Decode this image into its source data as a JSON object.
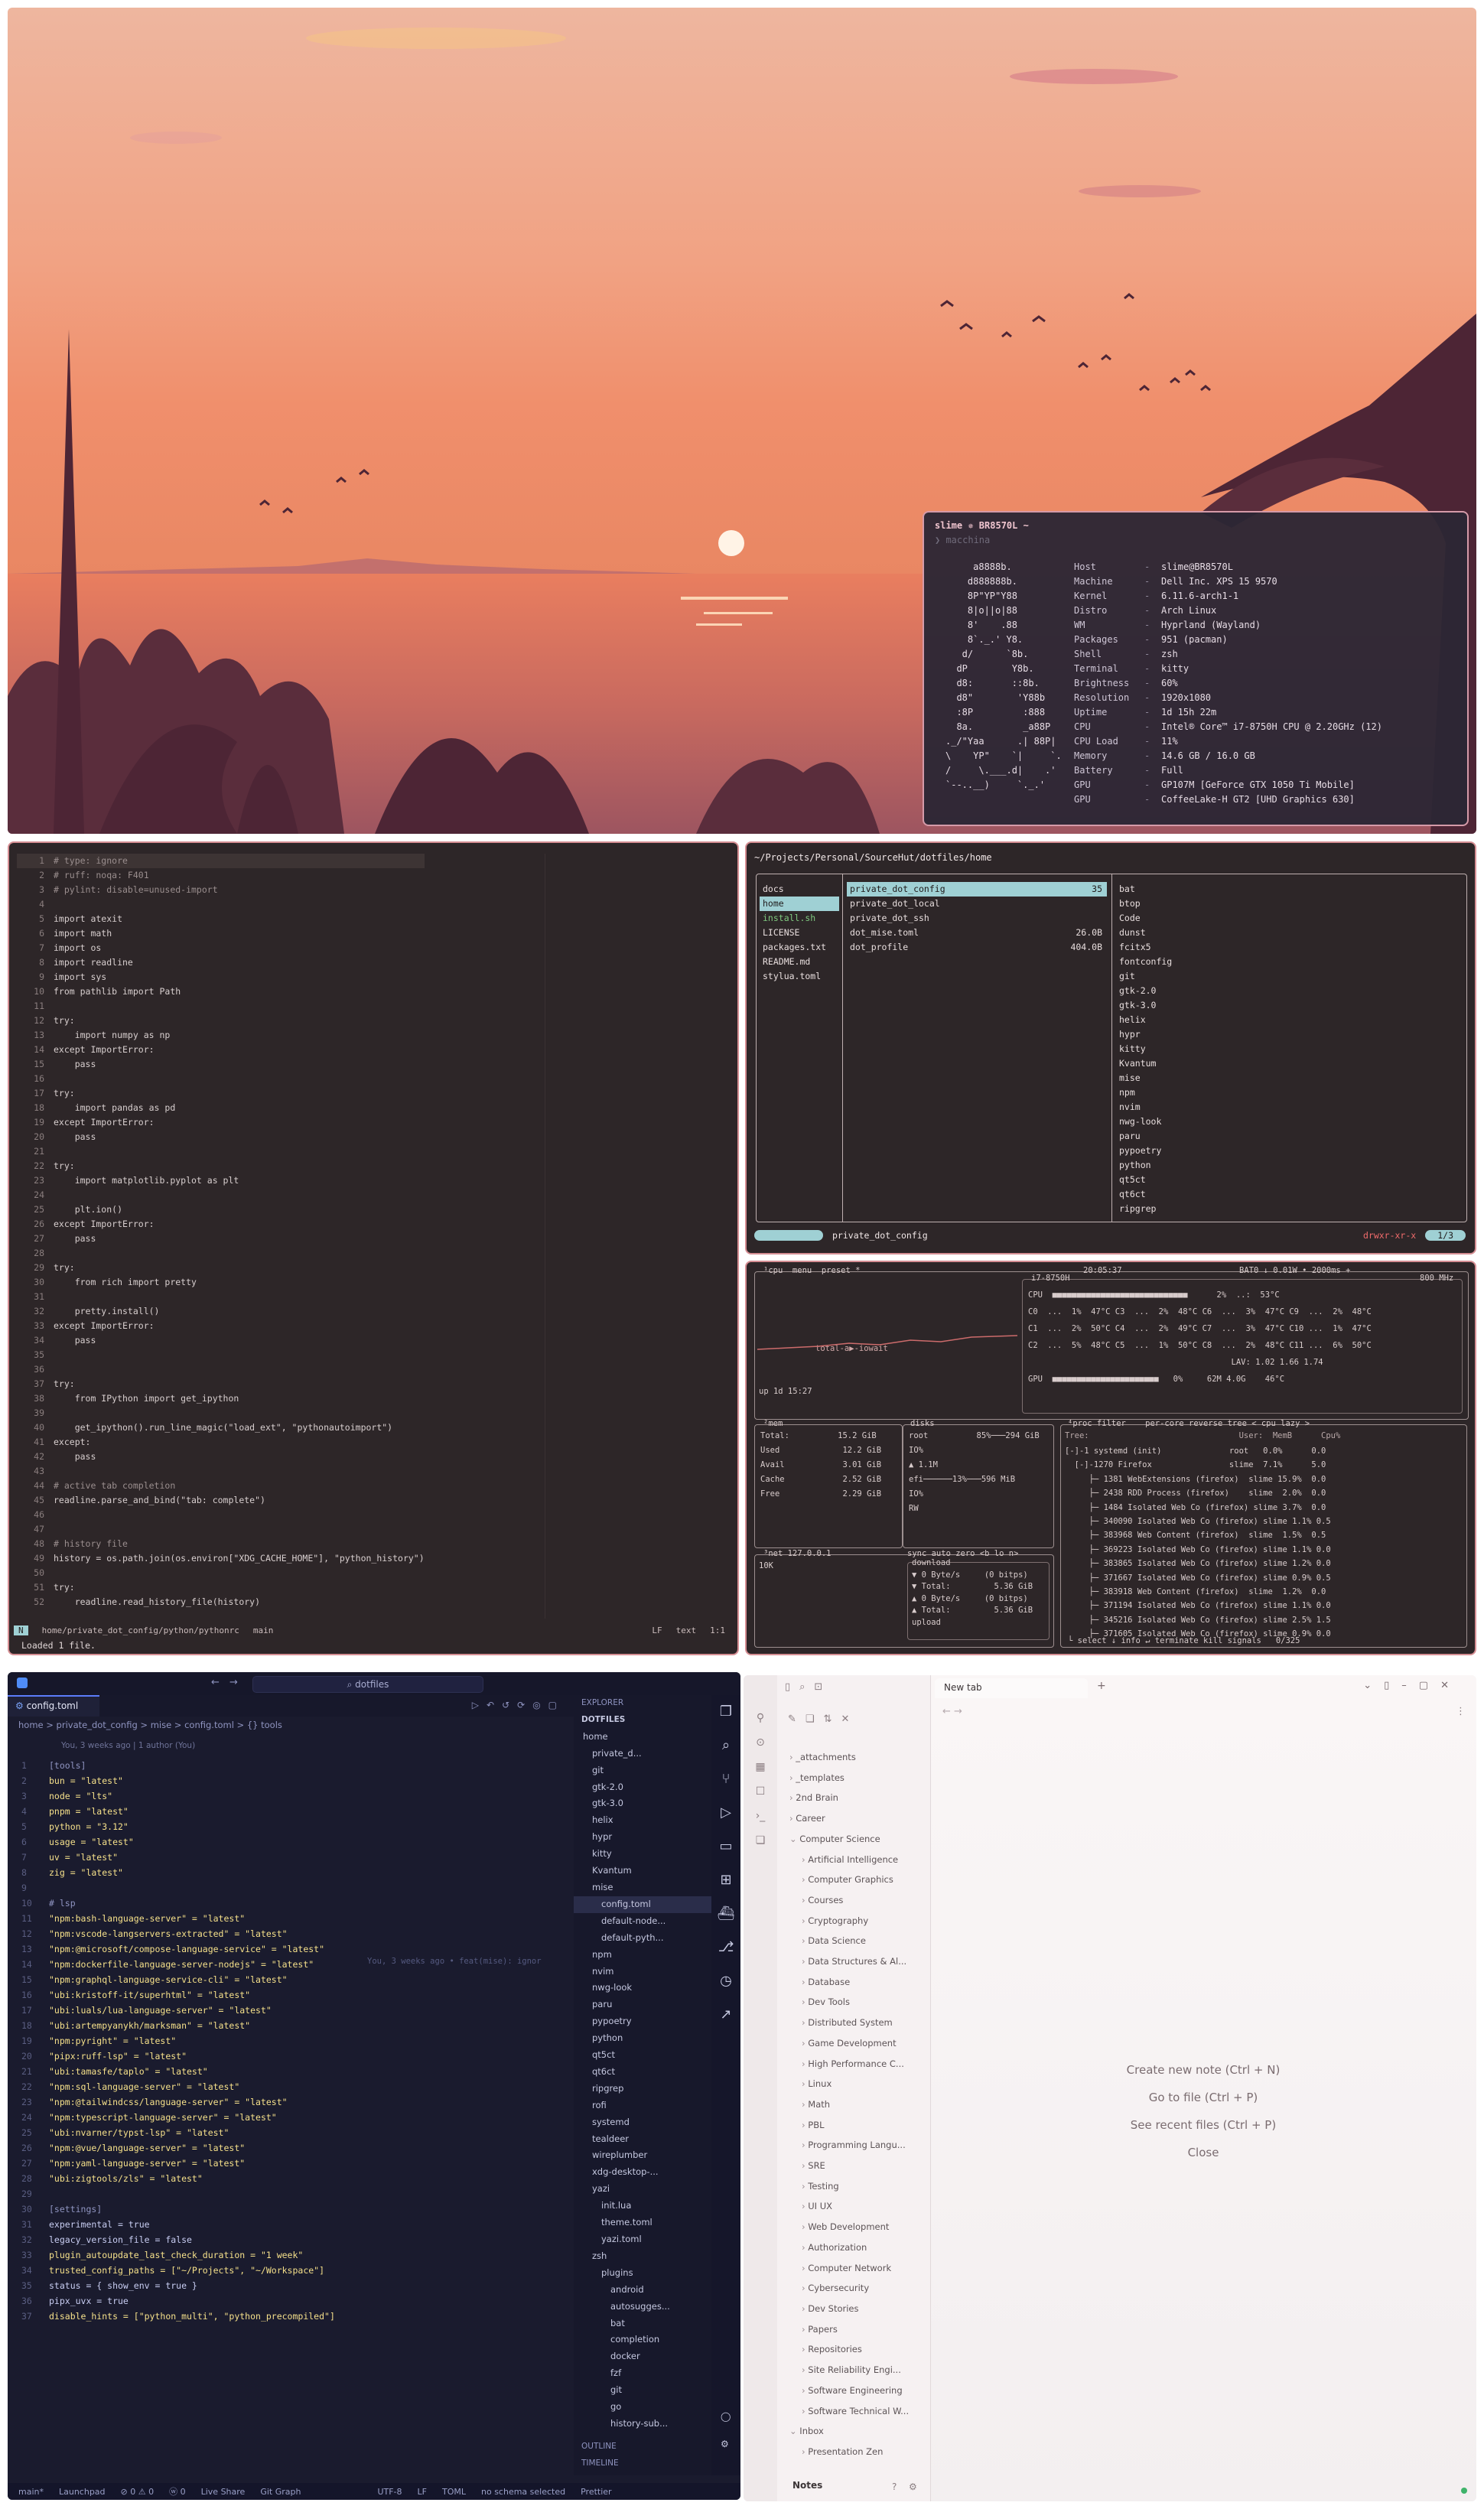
{
  "fastfetch": {
    "prompt": "slime ✵ BR8570L ~",
    "command": "❯ macchina",
    "logo": [
      "     a8888b.",
      "    d888888b.",
      "    8P\"YP\"Y88",
      "    8|o||o|88",
      "    8'    .88",
      "    8`._.' Y8.",
      "   d/      `8b.",
      "  dP        Y8b.",
      "  d8:       ::8b.",
      "  d8\"        'Y88b",
      "  :8P         :888",
      "  8a.         _a88P",
      "._/\"Yaa      .| 88P|",
      "\\    YP\"    `|     `.",
      "/     \\.___.d|    .'",
      "`--..__)     `._.'"
    ],
    "rows": [
      {
        "k": "Host",
        "v": "slime@BR8570L"
      },
      {
        "k": "Machine",
        "v": "Dell Inc. XPS 15 9570"
      },
      {
        "k": "Kernel",
        "v": "6.11.6-arch1-1"
      },
      {
        "k": "Distro",
        "v": "Arch Linux"
      },
      {
        "k": "WM",
        "v": "Hyprland (Wayland)"
      },
      {
        "k": "Packages",
        "v": "951 (pacman)"
      },
      {
        "k": "Shell",
        "v": "zsh"
      },
      {
        "k": "Terminal",
        "v": "kitty"
      },
      {
        "k": "Brightness",
        "v": "60%"
      },
      {
        "k": "Resolution",
        "v": "1920x1080"
      },
      {
        "k": "Uptime",
        "v": "1d 15h 22m"
      },
      {
        "k": "CPU",
        "v": "Intel® Core™ i7-8750H CPU @ 2.20GHz (12)"
      },
      {
        "k": "CPU Load",
        "v": "11%"
      },
      {
        "k": "Memory",
        "v": "14.6 GB / 16.0 GB"
      },
      {
        "k": "Battery",
        "v": "Full"
      },
      {
        "k": "GPU",
        "v": "GP107M [GeForce GTX 1050 Ti Mobile]"
      },
      {
        "k": "GPU",
        "v": "CoffeeLake-H GT2 [UHD Graphics 630]"
      }
    ]
  },
  "editor": {
    "lines": [
      "# type: ignore",
      "# ruff: noqa: F401",
      "# pylint: disable=unused-import",
      "",
      "import atexit",
      "import math",
      "import os",
      "import readline",
      "import sys",
      "from pathlib import Path",
      "",
      "try:",
      "    import numpy as np",
      "except ImportError:",
      "    pass",
      "",
      "try:",
      "    import pandas as pd",
      "except ImportError:",
      "    pass",
      "",
      "try:",
      "    import matplotlib.pyplot as plt",
      "",
      "    plt.ion()",
      "except ImportError:",
      "    pass",
      "",
      "try:",
      "    from rich import pretty",
      "",
      "    pretty.install()",
      "except ImportError:",
      "    pass",
      "",
      "",
      "try:",
      "    from IPython import get_ipython",
      "",
      "    get_ipython().run_line_magic(\"load_ext\", \"pythonautoimport\")",
      "except:",
      "    pass",
      "",
      "# active tab completion",
      "readline.parse_and_bind(\"tab: complete\")",
      "",
      "",
      "# history file",
      "history = os.path.join(os.environ[\"XDG_CACHE_HOME\"], \"python_history\")",
      "",
      "try:",
      "    readline.read_history_file(history)"
    ],
    "status_mode": "N",
    "status_path": "home/private_dot_config/python/pythonrc",
    "status_branch": "main",
    "status_lf": "LF",
    "status_ft": "text",
    "status_pos": "1:1",
    "message": "Loaded 1 file."
  },
  "yazi": {
    "path": "~/Projects/Personal/SourceHut/dotfiles/home",
    "parent": [
      "docs",
      "home",
      "install.sh",
      "LICENSE",
      "packages.txt",
      "README.md",
      "stylua.toml"
    ],
    "current": [
      {
        "name": "private_dot_config",
        "size": "35"
      },
      {
        "name": "private_dot_local",
        "size": ""
      },
      {
        "name": "private_dot_ssh",
        "size": ""
      },
      {
        "name": "dot_mise.toml",
        "size": "26.0B"
      },
      {
        "name": "dot_profile",
        "size": "404.0B"
      }
    ],
    "preview": [
      "bat",
      "btop",
      "Code",
      "dunst",
      "fcitx5",
      "fontconfig",
      "git",
      "gtk-2.0",
      "gtk-3.0",
      "helix",
      "hypr",
      "kitty",
      "Kvantum",
      "mise",
      "npm",
      "nvim",
      "nwg-look",
      "paru",
      "pypoetry",
      "python",
      "qt5ct",
      "qt6ct",
      "ripgrep"
    ],
    "status_left": "private_dot_config",
    "status_perm": "drwxr-xr-x",
    "status_pos": "1/3"
  },
  "btop": {
    "cpu_header": "¹cpu  menu  preset *",
    "time": "20:05:37",
    "batt": "BAT0 ↓ 0.01W • 2000ms +",
    "cpu_model": "i7-8750H",
    "freq": "800 MHz",
    "cpu_lines": [
      "CPU  ■■■■■■■■■■■■■■■■■■■■■■■■■■■■      2%  ..:  53°C",
      "C0  ...  1%  47°C C3  ...  2%  48°C C6  ...  3%  47°C C9  ...  2%  48°C",
      "C1  ...  2%  50°C C4  ...  2%  49°C C7  ...  3%  47°C C10 ...  1%  47°C",
      "C2  ...  5%  48°C C5  ...  1%  50°C C8  ...  2%  48°C C11 ...  6%  50°C",
      "                                          LAV: 1.02 1.66 1.74",
      "GPU  ■■■■■■■■■■■■■■■■■■■■■■   0%     62M 4.0G    46°C"
    ],
    "total": "total-a▶-iowait",
    "uptime": "up 1d 15:27",
    "mem": [
      "Total:          15.2 GiB",
      "Used             12.2 GiB",
      "Avail            3.01 GiB",
      "Cache            2.52 GiB",
      "Free             2.29 GiB"
    ],
    "disks": [
      "root          85%───294 GiB",
      "IO%",
      "▲ 1.1M",
      "efi──────13%───596 MiB",
      "IO%",
      "RW"
    ],
    "net_header": "³net 127.0.0.1",
    "net_modes": "sync auto zero <b lo n>",
    "net_scale": "10K",
    "net": [
      "download",
      "▼ 0 Byte/s     (0 bitps)",
      "▼ Total:         5.36 GiB",
      "▲ 0 Byte/s     (0 bitps)",
      "▲ Total:         5.36 GiB",
      "upload"
    ],
    "proc_header": "⁴proc filter    per-core reverse tree < cpu lazy >",
    "proc_cols": "Tree:                               User:  MemB      Cpu%",
    "procs": [
      "[-]-1 systemd (init)              root   0.0%      0.0",
      "  [-]-1270 Firefox                slime  7.1%      5.0",
      "     ├─ 1381 WebExtensions (firefox)  slime 15.9%  0.0",
      "     ├─ 2438 RDD Process (firefox)    slime  2.0%  0.0",
      "     ├─ 1484 Isolated Web Co (firefox) slime 3.7%  0.0",
      "     ├─ 340090 Isolated Web Co (firefox) slime 1.1% 0.5",
      "     ├─ 383968 Web Content (firefox)  slime  1.5%  0.5",
      "     ├─ 369223 Isolated Web Co (firefox) slime 1.1% 0.0",
      "     ├─ 383865 Isolated Web Co (firefox) slime 1.2% 0.0",
      "     ├─ 371667 Isolated Web Co (firefox) slime 0.9% 0.5",
      "     ├─ 383918 Web Content (firefox)  slime  1.2%  0.0",
      "     ├─ 371194 Isolated Web Co (firefox) slime 1.1% 0.0",
      "     ├─ 345216 Isolated Web Co (firefox) slime 2.5% 1.5",
      "     ├─ 371605 Isolated Web Co (firefox) slime 0.9% 0.0"
    ],
    "proc_footer": "└ select ↓ info ↵ terminate kill signals   0/325"
  },
  "vscode": {
    "search": "dotfiles",
    "tab": "config.toml",
    "breadcrumb": "home > private_dot_config > mise > config.toml > {} tools",
    "blame": "You, 3 weeks ago | 1 author (You)",
    "inline_blame": "You, 3 weeks ago • feat(mise): ignor",
    "code": [
      [
        "1",
        "[tools]"
      ],
      [
        "2",
        "bun = \"latest\""
      ],
      [
        "3",
        "node = \"lts\""
      ],
      [
        "4",
        "pnpm = \"latest\""
      ],
      [
        "5",
        "python = \"3.12\""
      ],
      [
        "6",
        "usage = \"latest\""
      ],
      [
        "7",
        "uv = \"latest\""
      ],
      [
        "8",
        "zig = \"latest\""
      ],
      [
        "9",
        ""
      ],
      [
        "10",
        "# lsp"
      ],
      [
        "11",
        "\"npm:bash-language-server\" = \"latest\""
      ],
      [
        "12",
        "\"npm:vscode-langservers-extracted\" = \"latest\""
      ],
      [
        "13",
        "\"npm:@microsoft/compose-language-service\" = \"latest\""
      ],
      [
        "14",
        "\"npm:dockerfile-language-server-nodejs\" = \"latest\""
      ],
      [
        "15",
        "\"npm:graphql-language-service-cli\" = \"latest\""
      ],
      [
        "16",
        "\"ubi:kristoff-it/superhtml\" = \"latest\""
      ],
      [
        "17",
        "\"ubi:luals/lua-language-server\" = \"latest\""
      ],
      [
        "18",
        "\"ubi:artempyanykh/marksman\" = \"latest\""
      ],
      [
        "19",
        "\"npm:pyright\" = \"latest\""
      ],
      [
        "20",
        "\"pipx:ruff-lsp\" = \"latest\""
      ],
      [
        "21",
        "\"ubi:tamasfe/taplo\" = \"latest\""
      ],
      [
        "22",
        "\"npm:sql-language-server\" = \"latest\""
      ],
      [
        "23",
        "\"npm:@tailwindcss/language-server\" = \"latest\""
      ],
      [
        "24",
        "\"npm:typescript-language-server\" = \"latest\""
      ],
      [
        "25",
        "\"ubi:nvarner/typst-lsp\" = \"latest\""
      ],
      [
        "26",
        "\"npm:@vue/language-server\" = \"latest\""
      ],
      [
        "27",
        "\"npm:yaml-language-server\" = \"latest\""
      ],
      [
        "28",
        "\"ubi:zigtools/zls\" = \"latest\""
      ],
      [
        "29",
        ""
      ],
      [
        "30",
        "[settings]"
      ],
      [
        "31",
        "experimental = true"
      ],
      [
        "32",
        "legacy_version_file = false"
      ],
      [
        "33",
        "plugin_autoupdate_last_check_duration = \"1 week\""
      ],
      [
        "34",
        "trusted_config_paths = [\"~/Projects\", \"~/Workspace\"]"
      ],
      [
        "35",
        "status = { show_env = true }"
      ],
      [
        "36",
        "pipx_uvx = true"
      ],
      [
        "37",
        "disable_hints = [\"python_multi\", \"python_precompiled\"]"
      ]
    ],
    "explorer_title": "EXPLORER",
    "explorer_root": "DOTFILES",
    "tree": [
      "home",
      "private_d...",
      "git",
      "gtk-2.0",
      "gtk-3.0",
      "helix",
      "hypr",
      "kitty",
      "Kvantum",
      "mise",
      "config.toml",
      "default-node...",
      "default-pyth...",
      "npm",
      "nvim",
      "nwg-look",
      "paru",
      "pypoetry",
      "python",
      "qt5ct",
      "qt6ct",
      "ripgrep",
      "rofi",
      "systemd",
      "tealdeer",
      "wireplumber",
      "xdg-desktop-...",
      "yazi",
      "init.lua",
      "theme.toml",
      "yazi.toml",
      "zsh",
      "plugins",
      "android",
      "autosugges...",
      "bat",
      "completion",
      "docker",
      "fzf",
      "git",
      "go",
      "history-sub..."
    ],
    "outline": "OUTLINE",
    "timeline": "TIMELINE",
    "status": [
      "main*",
      "Launchpad",
      "⊘ 0 ⚠ 0",
      "ⓦ 0",
      "Live Share",
      "Git Graph",
      "UTF-8",
      "LF",
      "TOML",
      "no schema selected",
      "Prettier"
    ]
  },
  "obsidian": {
    "tab": "New tab",
    "tree": [
      "_attachments",
      "_templates",
      "2nd Brain",
      "Career",
      "Computer Science",
      "Artificial Intelligence",
      "Computer Graphics",
      "Courses",
      "Cryptography",
      "Data Science",
      "Data Structures & Al...",
      "Database",
      "Dev Tools",
      "Distributed System",
      "Game Development",
      "High Performance C...",
      "Linux",
      "Math",
      "PBL",
      "Programming Langu...",
      "SRE",
      "Testing",
      "UI UX",
      "Web Development",
      "Authorization",
      "Computer Network",
      "Cybersecurity",
      "Dev Stories",
      "Papers",
      "Repositories",
      "Site Reliability Engi...",
      "Software Engineering",
      "Software Technical W...",
      "Inbox",
      "Presentation Zen"
    ],
    "vault": "Notes",
    "actions": [
      "Create new note (Ctrl + N)",
      "Go to file (Ctrl + P)",
      "See recent files (Ctrl + P)",
      "Close"
    ]
  }
}
